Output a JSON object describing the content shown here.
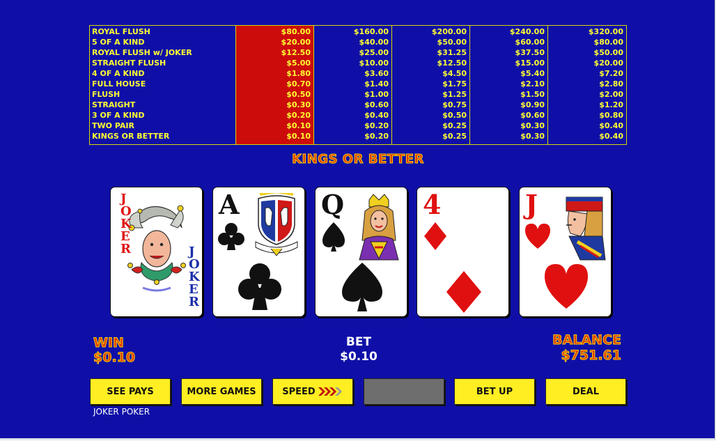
{
  "paytable": {
    "hands": [
      "ROYAL FLUSH",
      "5 OF A KIND",
      "ROYAL FLUSH w/ JOKER",
      "STRAIGHT FLUSH",
      "4 OF A KIND",
      "FULL HOUSE",
      "FLUSH",
      "STRAIGHT",
      "3 OF A KIND",
      "TWO PAIR",
      "KINGS OR BETTER"
    ],
    "columns": [
      {
        "values": [
          "$80.00",
          "$20.00",
          "$12.50",
          "$5.00",
          "$1.80",
          "$0.70",
          "$0.50",
          "$0.30",
          "$0.20",
          "$0.10",
          "$0.10"
        ],
        "selected": true
      },
      {
        "values": [
          "$160.00",
          "$40.00",
          "$25.00",
          "$10.00",
          "$3.60",
          "$1.40",
          "$1.00",
          "$0.60",
          "$0.40",
          "$0.20",
          "$0.20"
        ],
        "selected": false
      },
      {
        "values": [
          "$200.00",
          "$50.00",
          "$31.25",
          "$12.50",
          "$4.50",
          "$1.75",
          "$1.25",
          "$0.75",
          "$0.50",
          "$0.25",
          "$0.25"
        ],
        "selected": false
      },
      {
        "values": [
          "$240.00",
          "$60.00",
          "$37.50",
          "$15.00",
          "$5.40",
          "$2.10",
          "$1.50",
          "$0.90",
          "$0.60",
          "$0.30",
          "$0.30"
        ],
        "selected": false
      },
      {
        "values": [
          "$320.00",
          "$80.00",
          "$50.00",
          "$20.00",
          "$7.20",
          "$2.80",
          "$2.00",
          "$1.20",
          "$0.80",
          "$0.40",
          "$0.40"
        ],
        "selected": false
      }
    ]
  },
  "result_text": "KINGS OR BETTER",
  "cards": [
    {
      "rank": "JOKER",
      "suit": "joker",
      "color": "red"
    },
    {
      "rank": "A",
      "suit": "club",
      "color": "black"
    },
    {
      "rank": "Q",
      "suit": "spade",
      "color": "black"
    },
    {
      "rank": "4",
      "suit": "diamond",
      "color": "red"
    },
    {
      "rank": "J",
      "suit": "heart",
      "color": "red"
    }
  ],
  "status": {
    "win_label": "WIN",
    "win_value": "$0.10",
    "bet_label": "BET",
    "bet_value": "$0.10",
    "balance_label": "BALANCE",
    "balance_value": "$751.61"
  },
  "buttons": {
    "see_pays": "SEE PAYS",
    "more_games": "MORE GAMES",
    "speed": "SPEED",
    "blank": "",
    "bet_up": "BET UP",
    "deal": "DEAL"
  },
  "game_name": "JOKER POKER",
  "colors": {
    "background": "#0f0fa8",
    "paytable_text": "#ffff33",
    "selected_column": "#cc0b0b",
    "button": "#ffee22",
    "button_disabled": "#6e6e6e"
  }
}
